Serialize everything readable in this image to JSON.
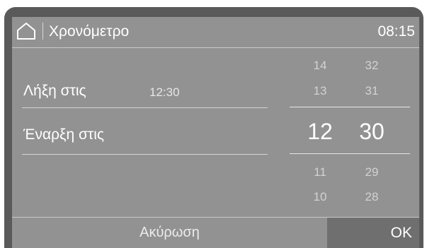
{
  "header": {
    "home_icon": "home-icon",
    "title": "Χρονόμετρο",
    "clock": "08:15"
  },
  "rows": [
    {
      "label": "Λήξη στις",
      "value": "12:30"
    },
    {
      "label": "Έναρξη στις",
      "value": ""
    }
  ],
  "picker": {
    "hours": {
      "above": [
        "14",
        "13"
      ],
      "selected": "12",
      "below": [
        "11",
        "10"
      ]
    },
    "minutes": {
      "above": [
        "32",
        "31"
      ],
      "selected": "30",
      "below": [
        "29",
        "28"
      ]
    }
  },
  "footer": {
    "cancel_label": "Ακύρωση",
    "ok_label": "OK"
  },
  "colors": {
    "bezel": "#5a5a5a",
    "screen": "#929292",
    "ok_button": "#6f6f6f",
    "text": "#ffffff"
  }
}
